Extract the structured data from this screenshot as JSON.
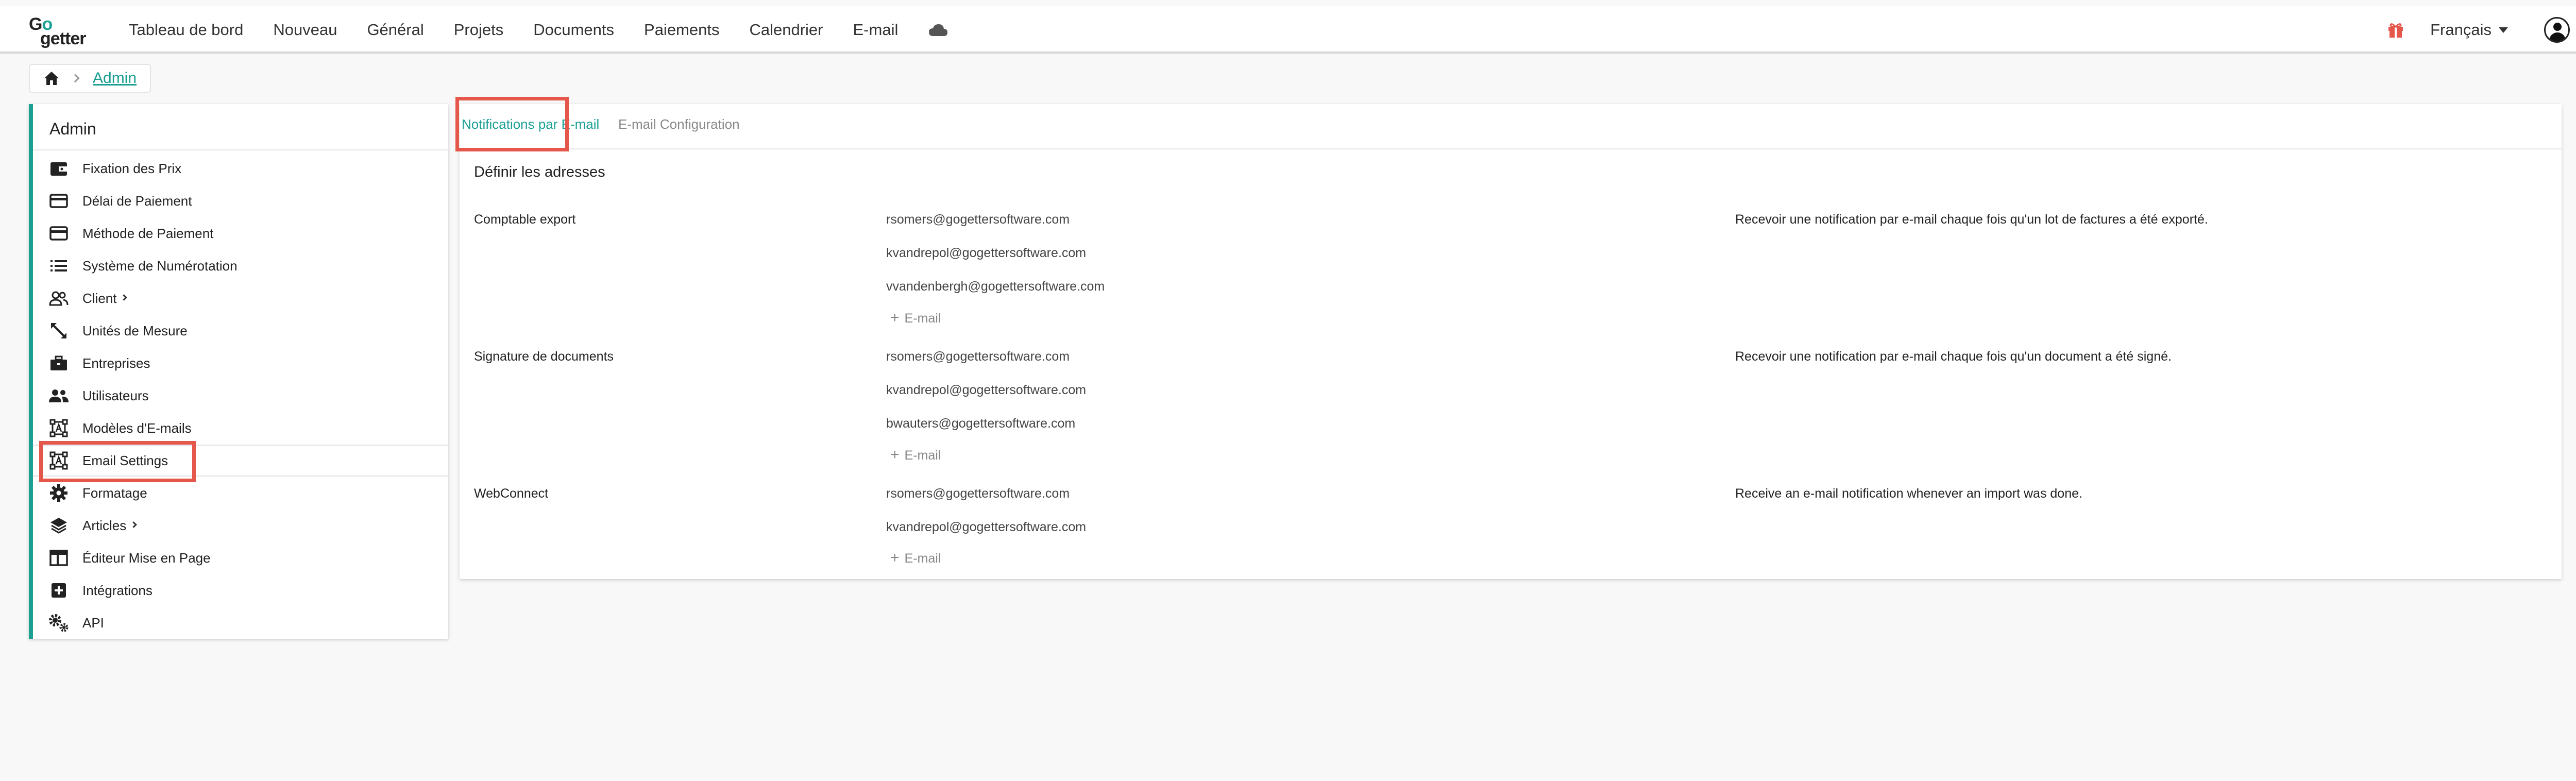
{
  "brand": {
    "logo_top": "Go",
    "logo_bottom": "getter"
  },
  "nav": {
    "items": [
      "Tableau de bord",
      "Nouveau",
      "Général",
      "Projets",
      "Documents",
      "Paiements",
      "Calendrier",
      "E-mail"
    ],
    "cloud_icon": "cloud-icon",
    "gift_icon": "gift-icon",
    "language": "Français"
  },
  "breadcrumb": {
    "home_icon": "home-icon",
    "current": "Admin"
  },
  "sidebar": {
    "title": "Admin",
    "items": [
      {
        "label": "Fixation des Prix",
        "icon": "wallet-icon"
      },
      {
        "label": "Délai de Paiement",
        "icon": "credit-card-icon"
      },
      {
        "label": "Méthode de Paiement",
        "icon": "credit-card-icon"
      },
      {
        "label": "Système de Numérotation",
        "icon": "list-icon"
      },
      {
        "label": "Client",
        "icon": "users-icon",
        "has_submenu": true
      },
      {
        "label": "Unités de Mesure",
        "icon": "resize-icon"
      },
      {
        "label": "Entreprises",
        "icon": "briefcase-icon"
      },
      {
        "label": "Utilisateurs",
        "icon": "people-icon"
      },
      {
        "label": "Modèles d'E-mails",
        "icon": "email-template-icon"
      },
      {
        "label": "Email Settings",
        "icon": "email-template-icon",
        "active": true
      },
      {
        "label": "Formatage",
        "icon": "gear-icon"
      },
      {
        "label": "Articles",
        "icon": "layers-icon",
        "has_submenu": true
      },
      {
        "label": "Éditeur Mise en Page",
        "icon": "layout-icon"
      },
      {
        "label": "Intégrations",
        "icon": "plus-box-icon"
      },
      {
        "label": "API",
        "icon": "gears-icon"
      }
    ]
  },
  "main": {
    "tabs": [
      {
        "label": "Notifications par E-mail",
        "active": true
      },
      {
        "label": "E-mail Configuration",
        "active": false
      }
    ],
    "section_title": "Définir les adresses",
    "add_label": "E-mail",
    "rows": [
      {
        "label": "Comptable export",
        "emails": [
          "rsomers@gogettersoftware.com",
          "kvandrepol@gogettersoftware.com",
          "vvandenbergh@gogettersoftware.com"
        ],
        "description": "Recevoir une notification par e-mail chaque fois qu'un lot de factures a été exporté."
      },
      {
        "label": "Signature de documents",
        "emails": [
          "rsomers@gogettersoftware.com",
          "kvandrepol@gogettersoftware.com",
          "bwauters@gogettersoftware.com"
        ],
        "description": "Recevoir une notification par e-mail chaque fois qu'un document a été signé."
      },
      {
        "label": "WebConnect",
        "emails": [
          "rsomers@gogettersoftware.com",
          "kvandrepol@gogettersoftware.com"
        ],
        "description": "Receive an e-mail notification whenever an import was done."
      }
    ]
  },
  "colors": {
    "accent": "#1a9f93",
    "highlight": "#e4574a",
    "gift": "#e4574a"
  }
}
